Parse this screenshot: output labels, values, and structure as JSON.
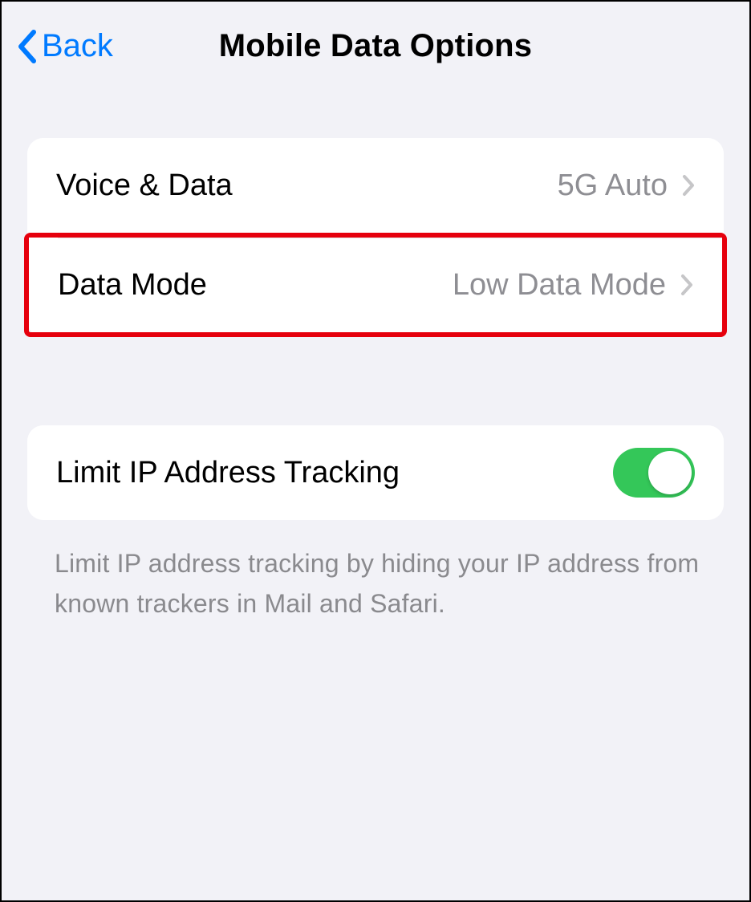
{
  "nav": {
    "back_label": "Back",
    "title": "Mobile Data Options"
  },
  "group1": {
    "voice_data": {
      "label": "Voice & Data",
      "value": "5G Auto"
    },
    "data_mode": {
      "label": "Data Mode",
      "value": "Low Data Mode"
    }
  },
  "group2": {
    "limit_ip": {
      "label": "Limit IP Address Tracking",
      "on": true
    },
    "footer": "Limit IP address tracking by hiding your IP address from known trackers in Mail and Safari."
  }
}
